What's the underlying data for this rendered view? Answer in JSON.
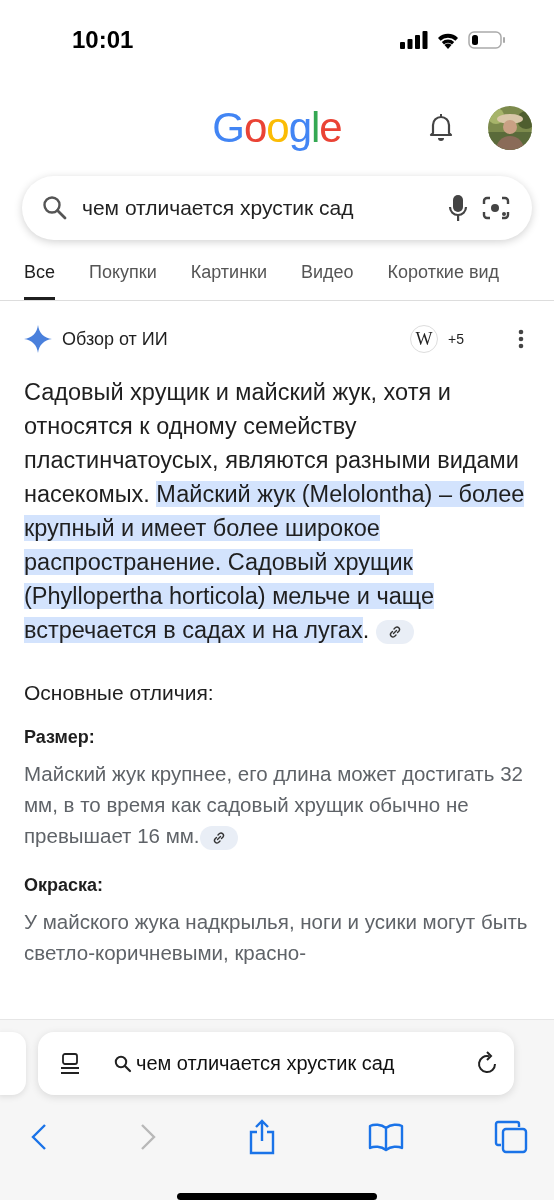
{
  "status_bar": {
    "time": "10:01"
  },
  "header": {
    "logo": "Google"
  },
  "search": {
    "value": "чем отличается хрустик сад"
  },
  "tabs": [
    {
      "label": "Все",
      "selected": true
    },
    {
      "label": "Покупки",
      "selected": false
    },
    {
      "label": "Картинки",
      "selected": false
    },
    {
      "label": "Видео",
      "selected": false
    },
    {
      "label": "Короткие вид",
      "selected": false
    }
  ],
  "ai_overview": {
    "title": "Обзор от ИИ",
    "source_badge": "W",
    "source_count": "+5",
    "summary": [
      {
        "text": "Садовый хрущик и майский жук, хотя и относятся к одному семейству пластинчатоусых, являются разными видами насекомых. ",
        "highlighted": false
      },
      {
        "text": "Майский жук (Melolontha) – более крупный и имеет более широкое распространение. Садовый хрущик (Phyllopertha horticola) мельче и чаще встречается в садах и на лугах",
        "highlighted": true
      },
      {
        "text": ".",
        "highlighted": false
      }
    ],
    "heading": "Основные отличия:",
    "sections": [
      {
        "title": "Размер:",
        "text": "Майский жук крупнее, его длина может достигать 32 мм, в то время как садовый хрущик обычно не превышает 16 мм.",
        "link": true
      },
      {
        "title": "Окраска:",
        "text": "У майского жука надкрылья, ноги и усики могут быть светло-коричневыми, красно-",
        "link": false
      }
    ]
  },
  "browser": {
    "address": "чем отличается хрустик сад"
  }
}
